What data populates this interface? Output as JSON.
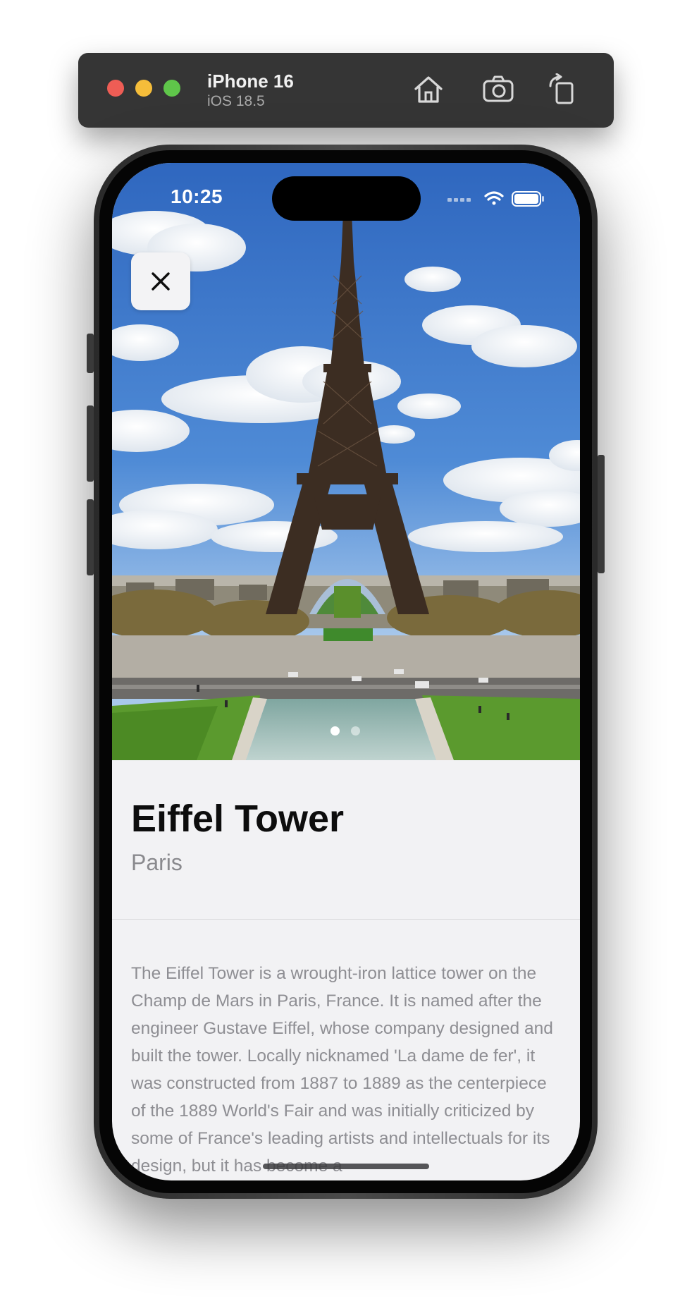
{
  "simulator": {
    "device_name": "iPhone 16",
    "os_version": "iOS 18.5",
    "buttons": [
      "home",
      "screenshot",
      "rotate"
    ]
  },
  "status_bar": {
    "time": "10:25",
    "icons": [
      "signal-icon",
      "wifi-icon",
      "battery-icon"
    ]
  },
  "detail": {
    "title": "Eiffel Tower",
    "subtitle": "Paris",
    "description": "The Eiffel Tower is a wrought-iron lattice tower on the Champ de Mars in Paris, France. It is named after the engineer Gustave Eiffel, whose company designed and built the tower. Locally nicknamed 'La dame de fer', it was constructed from 1887 to 1889 as the centerpiece of the 1889 World's Fair and was initially criticized by some of France's leading artists and intellectuals for its design, but it has become a",
    "close_icon": "close-icon",
    "gallery": {
      "page_count": 2,
      "current_page": 1
    }
  },
  "colors": {
    "background": "#f2f2f4",
    "title": "#0d0d0d",
    "secondary_text": "#8a8a8e",
    "sky": "#3f78c8"
  }
}
